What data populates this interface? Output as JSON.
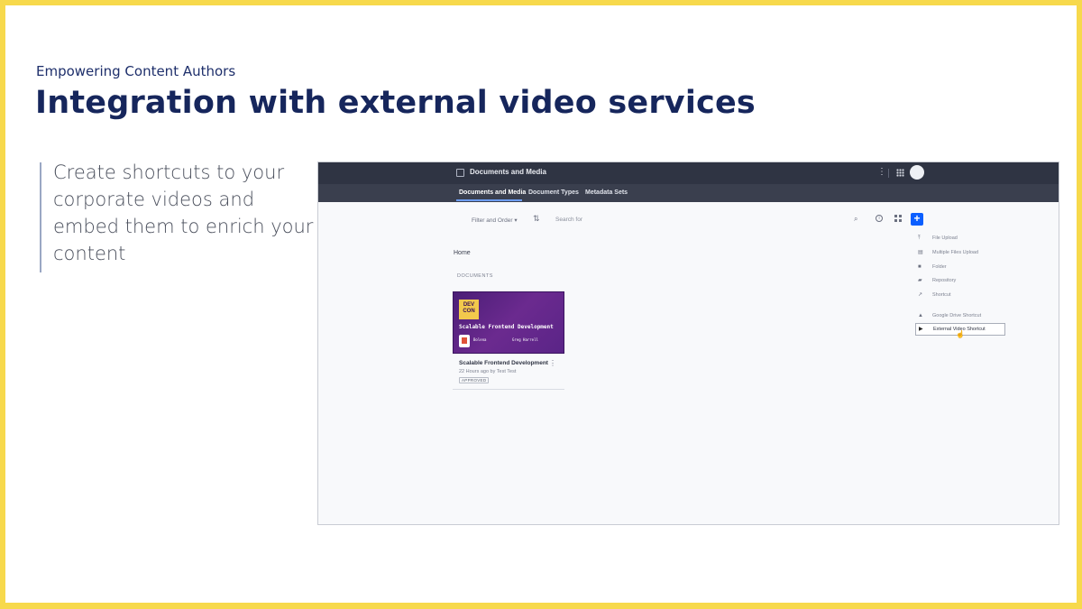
{
  "slide": {
    "kicker": "Empowering Content Authors",
    "title": "Integration with external video services",
    "body": "Create shortcuts to your corporate videos and embed them to enrich your content",
    "colors": {
      "border": "#f7d94c",
      "title": "#16265c",
      "accent": "#0b5fff"
    }
  },
  "app": {
    "header_title": "Documents and Media",
    "tabs": [
      {
        "label": "Documents and Media",
        "active": true
      },
      {
        "label": "Document Types",
        "active": false
      },
      {
        "label": "Metadata Sets",
        "active": false
      }
    ],
    "toolbar": {
      "filter_label": "Filter and Order",
      "sort_icon": "sort-icon",
      "search_placeholder": "Search for",
      "add_label": "+"
    },
    "breadcrumb": "Home",
    "section_label": "DOCUMENTS",
    "card": {
      "thumbnail_logo": "DEV CON",
      "thumbnail_title": "Scalable Frontend Development",
      "speaker_1": "Bolena",
      "speaker_2": "Greg Harrell",
      "title": "Scalable Frontend Development",
      "meta": "22 Hours ago by Test Test",
      "status": "APPROVED"
    },
    "menu": [
      {
        "label": "File Upload",
        "icon": "upload-icon"
      },
      {
        "label": "Multiple Files Upload",
        "icon": "files-icon"
      },
      {
        "label": "Folder",
        "icon": "folder-icon"
      },
      {
        "label": "Repository",
        "icon": "repository-icon"
      },
      {
        "label": "Shortcut",
        "icon": "shortcut-icon"
      },
      {
        "label": "Google Drive Shortcut",
        "icon": "google-drive-icon"
      },
      {
        "label": "External Video Shortcut",
        "icon": "video-icon",
        "highlighted": true
      }
    ]
  }
}
